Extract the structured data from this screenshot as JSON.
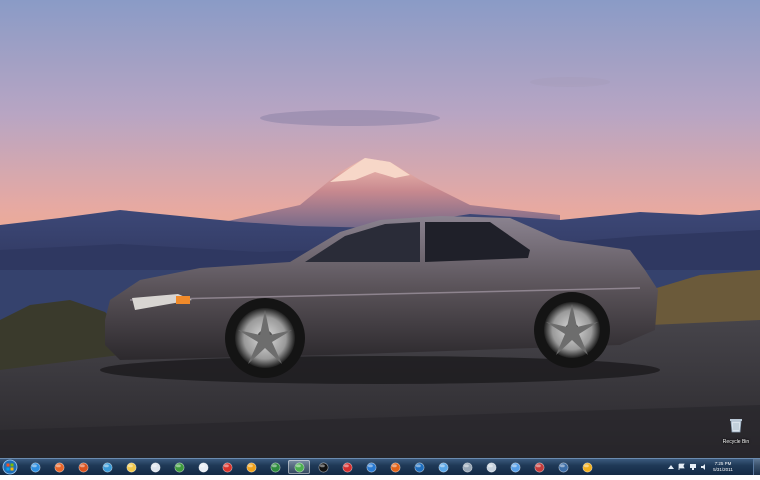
{
  "desktop": {
    "wallpaper_description": "",
    "icons": [
      {
        "label": "Recycle Bin",
        "icon": "recycle-bin-icon"
      }
    ]
  },
  "taskbar": {
    "start_icon": "windows-start-orb-icon",
    "pinned": [
      {
        "icon": "internet-explorer-icon",
        "color": "#2f8fe0"
      },
      {
        "icon": "firefox-icon",
        "color": "#e8662a"
      },
      {
        "icon": "firefox-icon",
        "color": "#d9531f"
      },
      {
        "icon": "chrome-icon",
        "color": "#3b9bd8"
      },
      {
        "icon": "folder-icon",
        "color": "#f2c94c"
      },
      {
        "icon": "notepad-icon",
        "color": "#dfe6ee"
      },
      {
        "icon": "dreamweaver-icon",
        "color": "#3e9b3e"
      },
      {
        "icon": "document-icon",
        "color": "#e9eef5"
      },
      {
        "icon": "calendar-icon",
        "color": "#d8342c"
      },
      {
        "icon": "media-player-icon",
        "color": "#f0a21b"
      },
      {
        "icon": "spreadsheet-icon",
        "color": "#2e8b3e"
      },
      {
        "icon": "chrome-icon",
        "color": "#4caf50",
        "active": true
      },
      {
        "icon": "mustache-icon",
        "color": "#111111"
      },
      {
        "icon": "red-app-icon",
        "color": "#d32f2f"
      },
      {
        "icon": "globe-icon",
        "color": "#2a7bd3"
      },
      {
        "icon": "pumpkin-icon",
        "color": "#e0631a"
      },
      {
        "icon": "photoshop-icon",
        "color": "#1f6fbf"
      },
      {
        "icon": "safari-icon",
        "color": "#5aa7e8"
      },
      {
        "icon": "settings-icon",
        "color": "#9aa9b8"
      },
      {
        "icon": "compass-icon",
        "color": "#c7d3df"
      },
      {
        "icon": "sphere-icon",
        "color": "#58a0e8"
      },
      {
        "icon": "stamp-icon",
        "color": "#c43c3c"
      },
      {
        "icon": "disc-icon",
        "color": "#3c6ea8"
      },
      {
        "icon": "sun-icon",
        "color": "#f2b01e"
      }
    ],
    "tray": [
      {
        "icon": "arrow-up-icon"
      },
      {
        "icon": "flag-icon"
      },
      {
        "icon": "network-icon"
      },
      {
        "icon": "volume-icon"
      }
    ],
    "clock": {
      "time": "7:25 PM",
      "date": "5/31/2011"
    }
  }
}
